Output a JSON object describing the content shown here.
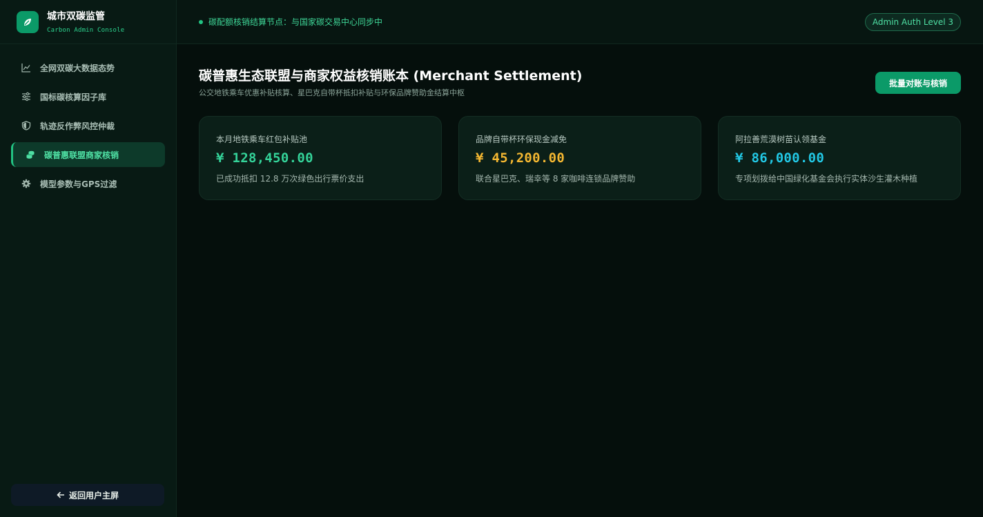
{
  "brand": {
    "title": "城市双碳监管",
    "subtitle": "Carbon Admin Console"
  },
  "sidebar": {
    "items": [
      {
        "label": "全网双碳大数据态势",
        "icon": "chart-line-icon",
        "active": false
      },
      {
        "label": "国标碳核算因子库",
        "icon": "sliders-icon",
        "active": false
      },
      {
        "label": "轨迹反作弊风控仲裁",
        "icon": "shield-icon",
        "active": false
      },
      {
        "label": "碳普惠联盟商家核销",
        "icon": "coins-icon",
        "active": true
      },
      {
        "label": "模型参数与GPS过滤",
        "icon": "gear-icon",
        "active": false
      }
    ],
    "back_label": "返回用户主屏"
  },
  "topbar": {
    "status_text": "碳配额核销结算节点：与国家碳交易中心同步中",
    "auth_badge": "Admin Auth Level 3"
  },
  "page": {
    "title": "碳普惠生态联盟与商家权益核销账本 (Merchant Settlement)",
    "subtitle": "公交地铁乘车优惠补贴核算、星巴克自带杯抵扣补贴与环保品牌赞助金结算中枢",
    "primary_button": "批量对账与核销"
  },
  "cards": [
    {
      "label": "本月地铁乘车红包补贴池",
      "value": "¥ 128,450.00",
      "note": "已成功抵扣 12.8 万次绿色出行票价支出",
      "color": "#34d399"
    },
    {
      "label": "品牌自带杯环保现金减免",
      "value": "¥ 45,200.00",
      "note": "联合星巴克、瑞幸等 8 家咖啡连锁品牌赞助",
      "color": "#f4b731"
    },
    {
      "label": "阿拉善荒漠树苗认领基金",
      "value": "¥ 86,000.00",
      "note": "专项划拨给中国绿化基金会执行实体沙生灌木种植",
      "color": "#22c8e5"
    }
  ],
  "colors": {
    "accent": "#0b9a68",
    "active_text": "#4fe0a4",
    "background": "#050f0c"
  }
}
